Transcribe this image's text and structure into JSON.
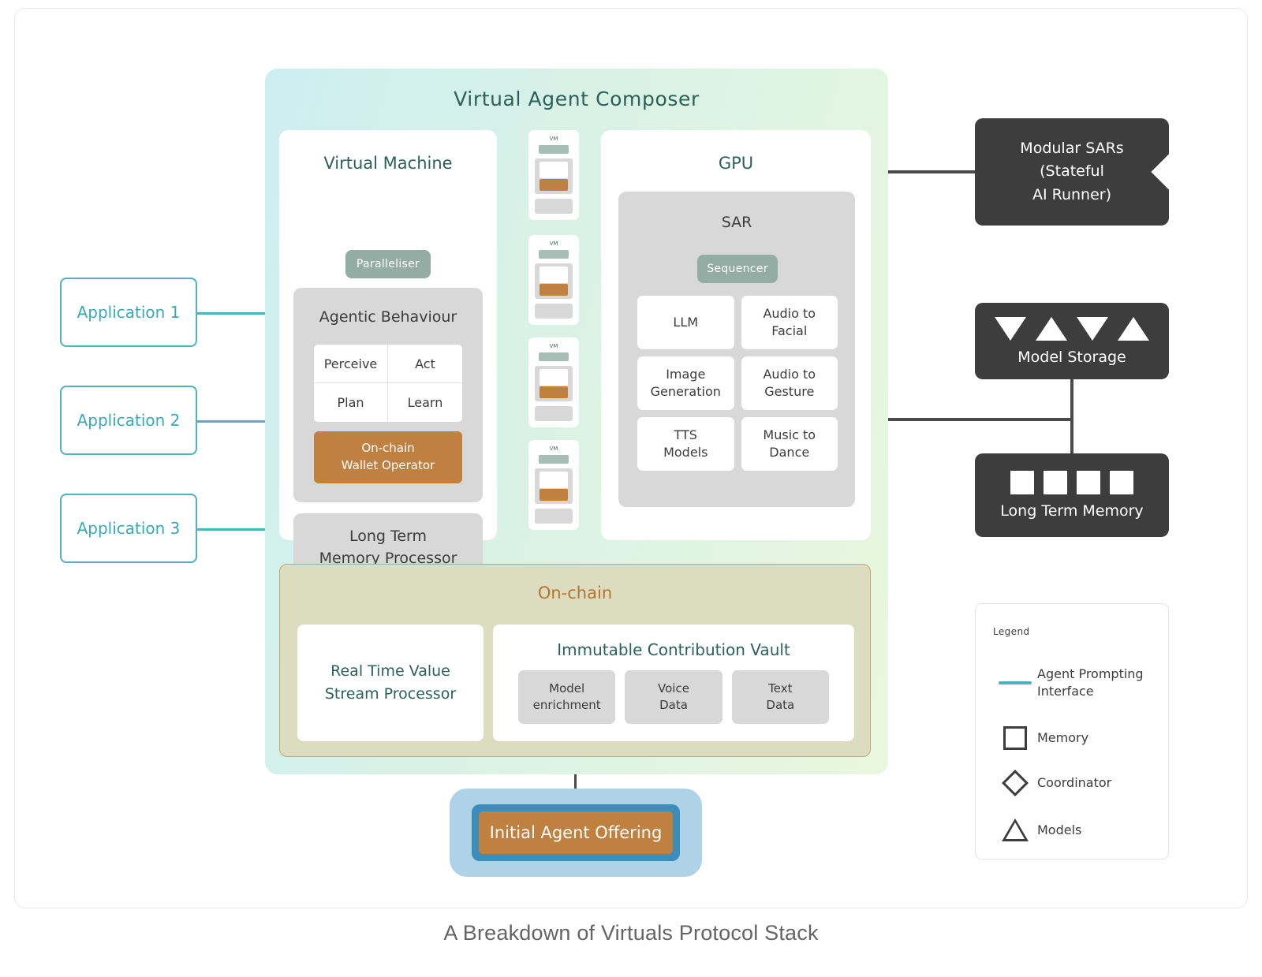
{
  "caption": "A Breakdown of Virtuals Protocol Stack",
  "composer": {
    "title": "Virtual Agent Composer",
    "virtual_machine": {
      "title": "Virtual Machine",
      "paralleliser_label": "Paralleliser",
      "agentic_behaviour": {
        "title": "Agentic Behaviour",
        "cells": [
          "Perceive",
          "Act",
          "Plan",
          "Learn"
        ],
        "wallet_operator": {
          "line1": "On-chain",
          "line2": "Wallet Operator"
        }
      },
      "long_term_memory_processor": {
        "line1": "Long Term",
        "line2": "Memory Processor"
      }
    },
    "vm_stack": [
      {
        "label": "VM"
      },
      {
        "label": "VM"
      },
      {
        "label": "VM"
      },
      {
        "label": "VM"
      }
    ],
    "gpu": {
      "title": "GPU",
      "sar": {
        "title": "SAR",
        "sequencer_label": "Sequencer",
        "models": [
          {
            "line1": "LLM",
            "line2": ""
          },
          {
            "line1": "Audio to",
            "line2": "Facial"
          },
          {
            "line1": "Image",
            "line2": "Generation"
          },
          {
            "line1": "Audio to",
            "line2": "Gesture"
          },
          {
            "line1": "TTS",
            "line2": "Models"
          },
          {
            "line1": "Music to",
            "line2": "Dance"
          }
        ]
      }
    },
    "onchain": {
      "title": "On-chain",
      "real_time_value_stream_processor": {
        "line1": "Real Time Value",
        "line2": "Stream Processor"
      },
      "immutable_contribution_vault": {
        "title": "Immutable Contribution Vault",
        "items": [
          {
            "line1": "Model",
            "line2": "enrichment"
          },
          {
            "line1": "Voice",
            "line2": "Data"
          },
          {
            "line1": "Text",
            "line2": "Data"
          }
        ]
      }
    }
  },
  "applications": [
    {
      "label": "Application 1"
    },
    {
      "label": "Application 2"
    },
    {
      "label": "Application 3"
    }
  ],
  "right_nodes": {
    "modular_sars": {
      "line1": "Modular SARs",
      "line2": "(Stateful",
      "line3": "AI Runner)"
    },
    "model_storage": {
      "label": "Model Storage"
    },
    "long_term_memory": {
      "label": "Long Term Memory"
    }
  },
  "initial_agent_offering": {
    "label": "Initial Agent Offering"
  },
  "legend": {
    "title": "Legend",
    "items": [
      {
        "symbol": "line",
        "line1": "Agent Prompting",
        "line2": "Interface"
      },
      {
        "symbol": "square",
        "line1": "Memory",
        "line2": ""
      },
      {
        "symbol": "diamond",
        "line1": "Coordinator",
        "line2": ""
      },
      {
        "symbol": "triangle",
        "line1": "Models",
        "line2": ""
      }
    ]
  },
  "colors": {
    "teal_accent": "#4eb3bd",
    "deep_teal_text": "#2c6158",
    "sage": "#93ada4",
    "brown": "#c08040",
    "olive_fill": "#dcdcc0",
    "olive_border": "#c3a76e",
    "onchain_title": "#b5742e",
    "dark_node": "#3d3d3d",
    "grey_box": "#d8d8d8",
    "iao_outer": "#aed2e8",
    "iao_mid": "#3b8dba"
  }
}
